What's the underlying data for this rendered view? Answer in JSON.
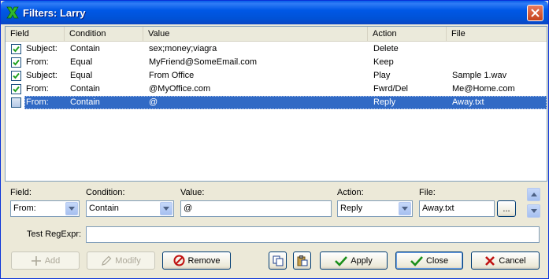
{
  "window": {
    "title": "Filters: Larry"
  },
  "list": {
    "headers": {
      "field": "Field",
      "condition": "Condition",
      "value": "Value",
      "action": "Action",
      "file": "File"
    },
    "rows": [
      {
        "checked": true,
        "field": "Subject:",
        "condition": "Contain",
        "value": "sex;money;viagra",
        "action": "Delete",
        "file": ""
      },
      {
        "checked": true,
        "field": "From:",
        "condition": "Equal",
        "value": "MyFriend@SomeEmail.com",
        "action": "Keep",
        "file": ""
      },
      {
        "checked": true,
        "field": "Subject:",
        "condition": "Equal",
        "value": "From Office",
        "action": "Play",
        "file": "Sample 1.wav"
      },
      {
        "checked": true,
        "field": "From:",
        "condition": "Contain",
        "value": "@MyOffice.com",
        "action": "Fwrd/Del",
        "file": "Me@Home.com"
      },
      {
        "checked": false,
        "selected": true,
        "field": "From:",
        "condition": "Contain",
        "value": "@",
        "action": "Reply",
        "file": "Away.txt"
      }
    ]
  },
  "editor": {
    "field_label": "Field:",
    "field_value": "From:",
    "condition_label": "Condition:",
    "condition_value": "Contain",
    "value_label": "Value:",
    "value_value": "@",
    "action_label": "Action:",
    "action_value": "Reply",
    "file_label": "File:",
    "file_value": "Away.txt",
    "browse_label": "...",
    "regexp_label": "Test RegExpr:",
    "regexp_value": ""
  },
  "buttons": {
    "add": "Add",
    "modify": "Modify",
    "remove": "Remove",
    "apply": "Apply",
    "close": "Close",
    "cancel": "Cancel"
  },
  "colors": {
    "selection": "#316ac5",
    "titlebar": "#0058e6",
    "ok_green": "#1a8f1a",
    "cancel_red": "#c01010"
  }
}
